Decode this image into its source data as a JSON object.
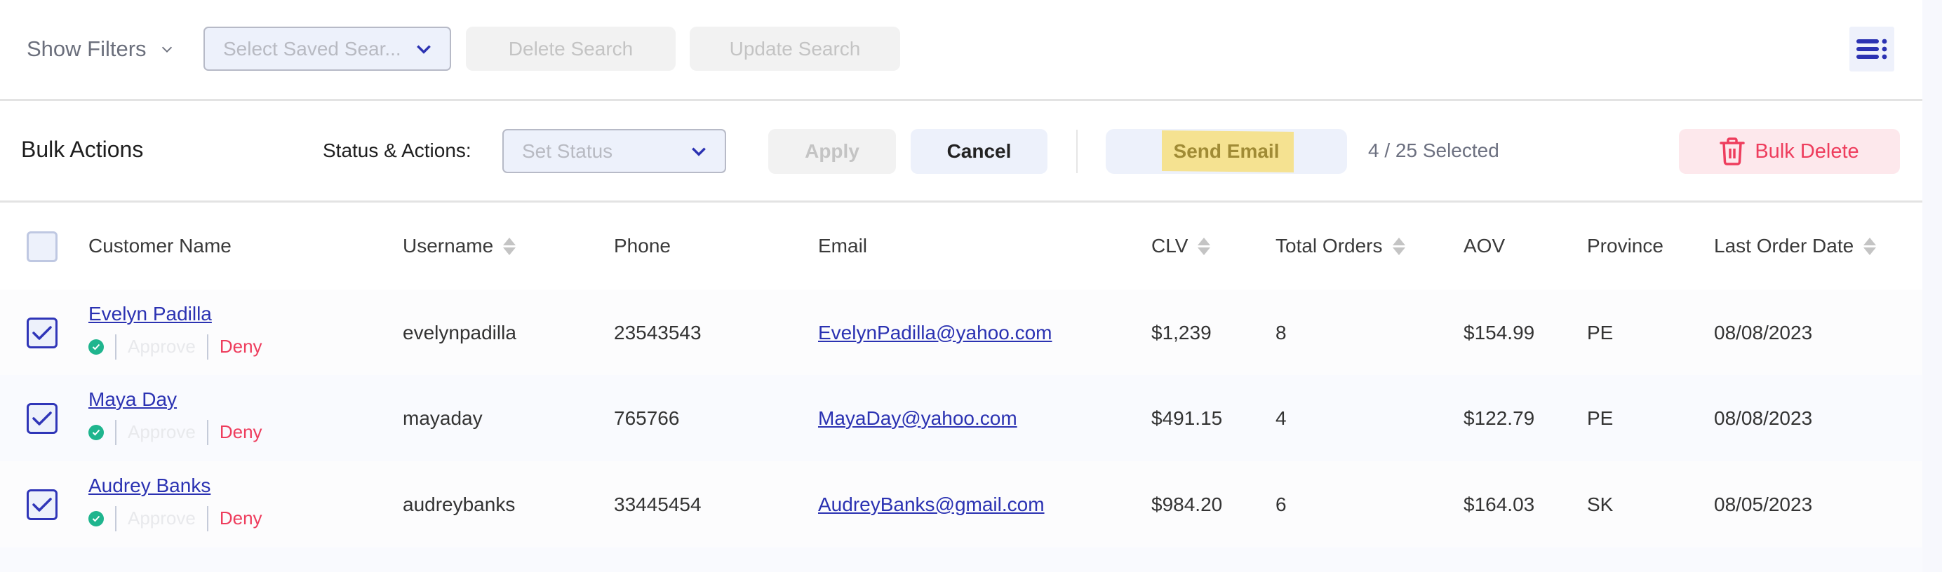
{
  "topbar": {
    "show_filters_label": "Show Filters",
    "saved_search_placeholder": "Select Saved Sear...",
    "delete_search_label": "Delete Search",
    "update_search_label": "Update Search",
    "menu_icon": "list-menu-icon"
  },
  "bulk": {
    "title": "Bulk Actions",
    "status_label": "Status & Actions:",
    "status_placeholder": "Set Status",
    "apply_label": "Apply",
    "cancel_label": "Cancel",
    "send_email_label": "Send Email",
    "selected_count": "4 / 25 Selected",
    "bulk_delete_label": "Bulk Delete"
  },
  "table": {
    "columns": {
      "customer_name": "Customer Name",
      "username": "Username",
      "phone": "Phone",
      "email": "Email",
      "clv": "CLV",
      "total_orders": "Total Orders",
      "aov": "AOV",
      "province": "Province",
      "last_order_date": "Last Order Date"
    },
    "approve_label": "Approve",
    "deny_label": "Deny",
    "rows": [
      {
        "name": "Evelyn Padilla",
        "username": "evelynpadilla",
        "phone": "23543543",
        "email": "EvelynPadilla@yahoo.com",
        "clv": "$1,239",
        "total_orders": "8",
        "aov": "$154.99",
        "province": "PE",
        "last_order_date": "08/08/2023",
        "checked": true
      },
      {
        "name": "Maya Day",
        "username": "mayaday",
        "phone": "765766",
        "email": "MayaDay@yahoo.com",
        "clv": "$491.15",
        "total_orders": "4",
        "aov": "$122.79",
        "province": "PE",
        "last_order_date": "08/08/2023",
        "checked": true
      },
      {
        "name": "Audrey Banks",
        "username": "audreybanks",
        "phone": "33445454",
        "email": "AudreyBanks@gmail.com",
        "clv": "$984.20",
        "total_orders": "6",
        "aov": "$164.03",
        "province": "SK",
        "last_order_date": "08/05/2023",
        "checked": true
      }
    ]
  },
  "colors": {
    "accent": "#2b32b2",
    "danger": "#ee3d5d",
    "success": "#1fb58e",
    "highlight": "#f5e291"
  }
}
